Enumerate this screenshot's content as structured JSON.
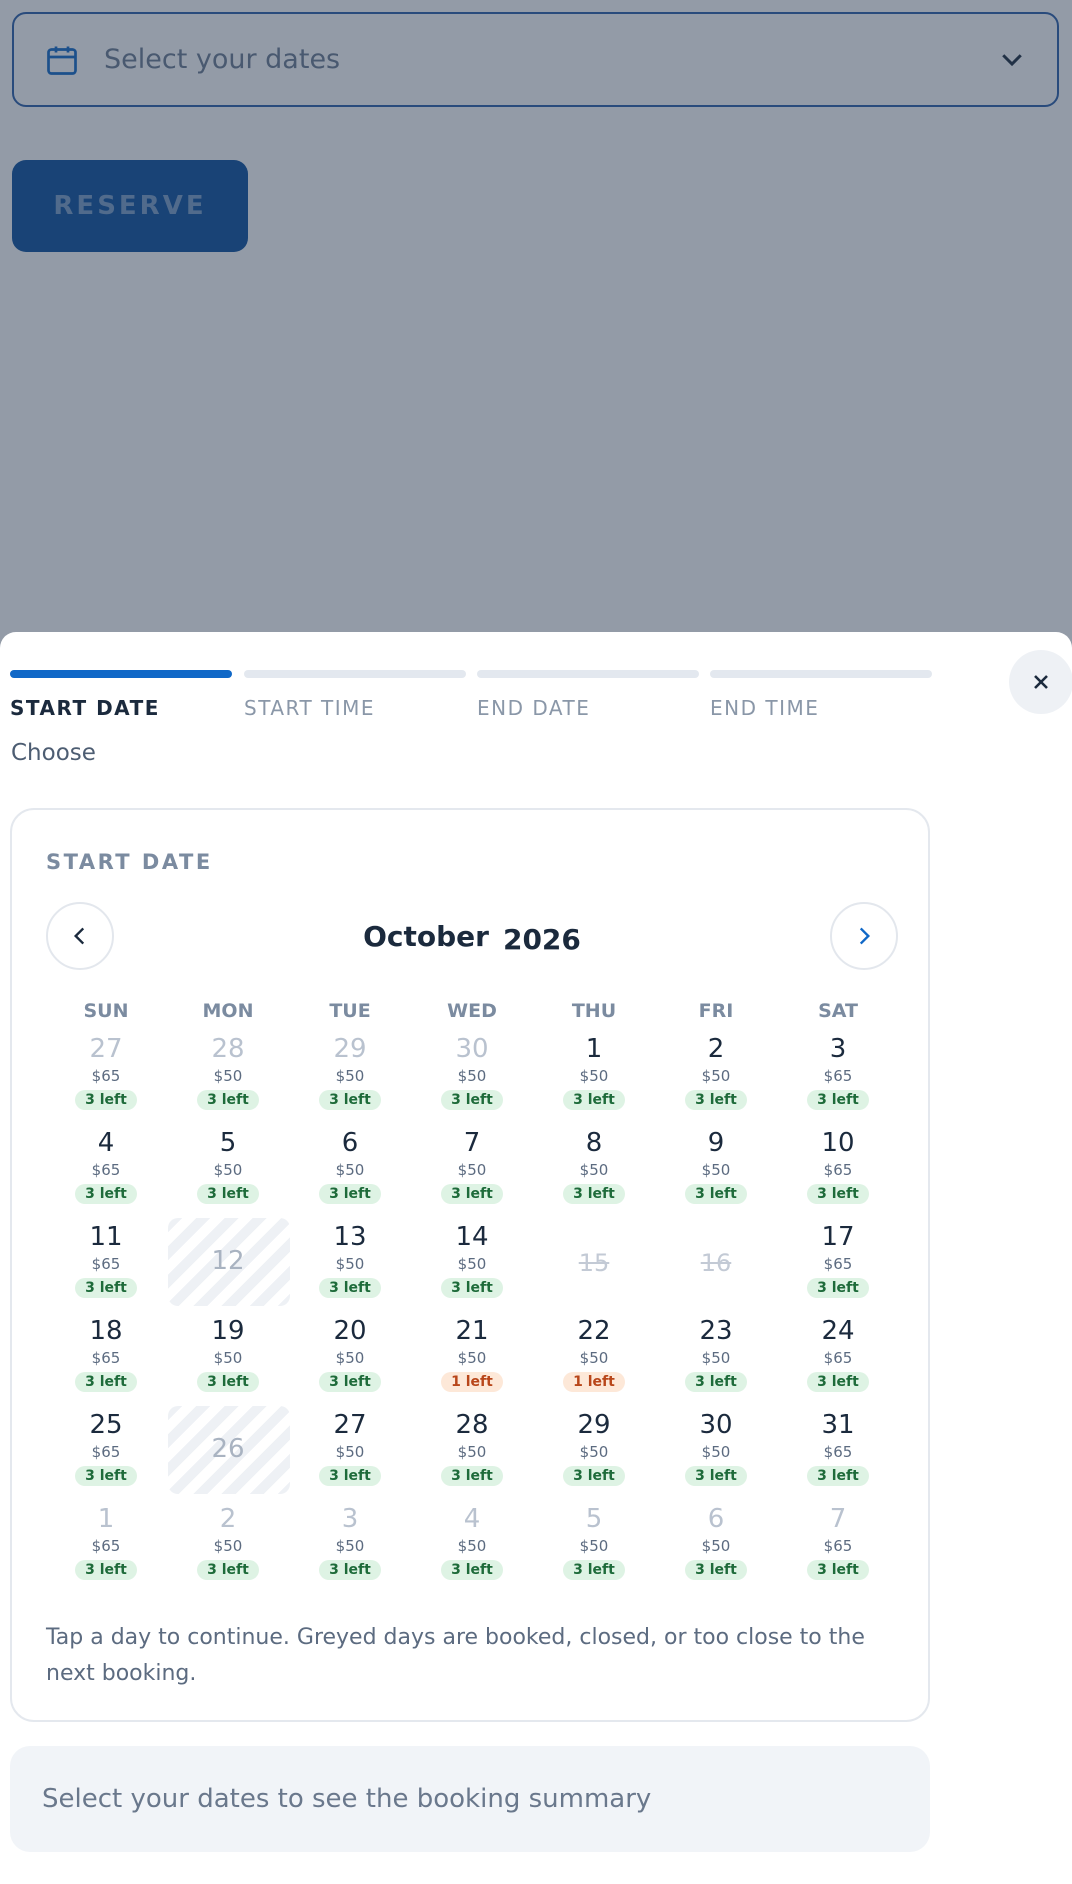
{
  "background": {
    "date_placeholder": "Select your dates",
    "reserve_label": "RESERVE"
  },
  "sheet": {
    "steps": [
      {
        "label": "START DATE",
        "active": true
      },
      {
        "label": "START TIME",
        "active": false
      },
      {
        "label": "END DATE",
        "active": false
      },
      {
        "label": "END TIME",
        "active": false
      }
    ],
    "subtitle": "Choose"
  },
  "calendar": {
    "title": "START DATE",
    "month": "October",
    "year": "2026",
    "weekdays": [
      "SUN",
      "MON",
      "TUE",
      "WED",
      "THU",
      "FRI",
      "SAT"
    ],
    "days": [
      {
        "num": "27",
        "price": "$65",
        "left": "3 left",
        "status": "out"
      },
      {
        "num": "28",
        "price": "$50",
        "left": "3 left",
        "status": "out"
      },
      {
        "num": "29",
        "price": "$50",
        "left": "3 left",
        "status": "out"
      },
      {
        "num": "30",
        "price": "$50",
        "left": "3 left",
        "status": "out"
      },
      {
        "num": "1",
        "price": "$50",
        "left": "3 left",
        "status": "ok"
      },
      {
        "num": "2",
        "price": "$50",
        "left": "3 left",
        "status": "ok"
      },
      {
        "num": "3",
        "price": "$65",
        "left": "3 left",
        "status": "ok"
      },
      {
        "num": "4",
        "price": "$65",
        "left": "3 left",
        "status": "ok"
      },
      {
        "num": "5",
        "price": "$50",
        "left": "3 left",
        "status": "ok"
      },
      {
        "num": "6",
        "price": "$50",
        "left": "3 left",
        "status": "ok"
      },
      {
        "num": "7",
        "price": "$50",
        "left": "3 left",
        "status": "ok"
      },
      {
        "num": "8",
        "price": "$50",
        "left": "3 left",
        "status": "ok"
      },
      {
        "num": "9",
        "price": "$50",
        "left": "3 left",
        "status": "ok"
      },
      {
        "num": "10",
        "price": "$65",
        "left": "3 left",
        "status": "ok"
      },
      {
        "num": "11",
        "price": "$65",
        "left": "3 left",
        "status": "ok"
      },
      {
        "num": "12",
        "price": "",
        "left": "",
        "status": "blocked"
      },
      {
        "num": "13",
        "price": "$50",
        "left": "3 left",
        "status": "ok"
      },
      {
        "num": "14",
        "price": "$50",
        "left": "3 left",
        "status": "ok"
      },
      {
        "num": "15",
        "price": "",
        "left": "",
        "status": "closed"
      },
      {
        "num": "16",
        "price": "",
        "left": "",
        "status": "closed"
      },
      {
        "num": "17",
        "price": "$65",
        "left": "3 left",
        "status": "ok"
      },
      {
        "num": "18",
        "price": "$65",
        "left": "3 left",
        "status": "ok"
      },
      {
        "num": "19",
        "price": "$50",
        "left": "3 left",
        "status": "ok"
      },
      {
        "num": "20",
        "price": "$50",
        "left": "3 left",
        "status": "ok"
      },
      {
        "num": "21",
        "price": "$50",
        "left": "1 left",
        "status": "warn"
      },
      {
        "num": "22",
        "price": "$50",
        "left": "1 left",
        "status": "warn"
      },
      {
        "num": "23",
        "price": "$50",
        "left": "3 left",
        "status": "ok"
      },
      {
        "num": "24",
        "price": "$65",
        "left": "3 left",
        "status": "ok"
      },
      {
        "num": "25",
        "price": "$65",
        "left": "3 left",
        "status": "ok"
      },
      {
        "num": "26",
        "price": "",
        "left": "",
        "status": "blocked"
      },
      {
        "num": "27",
        "price": "$50",
        "left": "3 left",
        "status": "ok"
      },
      {
        "num": "28",
        "price": "$50",
        "left": "3 left",
        "status": "ok"
      },
      {
        "num": "29",
        "price": "$50",
        "left": "3 left",
        "status": "ok"
      },
      {
        "num": "30",
        "price": "$50",
        "left": "3 left",
        "status": "ok"
      },
      {
        "num": "31",
        "price": "$65",
        "left": "3 left",
        "status": "ok"
      },
      {
        "num": "1",
        "price": "$65",
        "left": "3 left",
        "status": "out"
      },
      {
        "num": "2",
        "price": "$50",
        "left": "3 left",
        "status": "out"
      },
      {
        "num": "3",
        "price": "$50",
        "left": "3 left",
        "status": "out"
      },
      {
        "num": "4",
        "price": "$50",
        "left": "3 left",
        "status": "out"
      },
      {
        "num": "5",
        "price": "$50",
        "left": "3 left",
        "status": "out"
      },
      {
        "num": "6",
        "price": "$50",
        "left": "3 left",
        "status": "out"
      },
      {
        "num": "7",
        "price": "$65",
        "left": "3 left",
        "status": "out"
      }
    ],
    "hint": "Tap a day to continue. Greyed days are booked, closed, or too close to the next booking."
  },
  "summary": {
    "text": "Select your dates to see the booking summary"
  },
  "colors": {
    "accent": "#1068c7",
    "brand": "#0a4f9c",
    "available_badge": "#def3e4",
    "low_badge": "#fde8d8"
  }
}
